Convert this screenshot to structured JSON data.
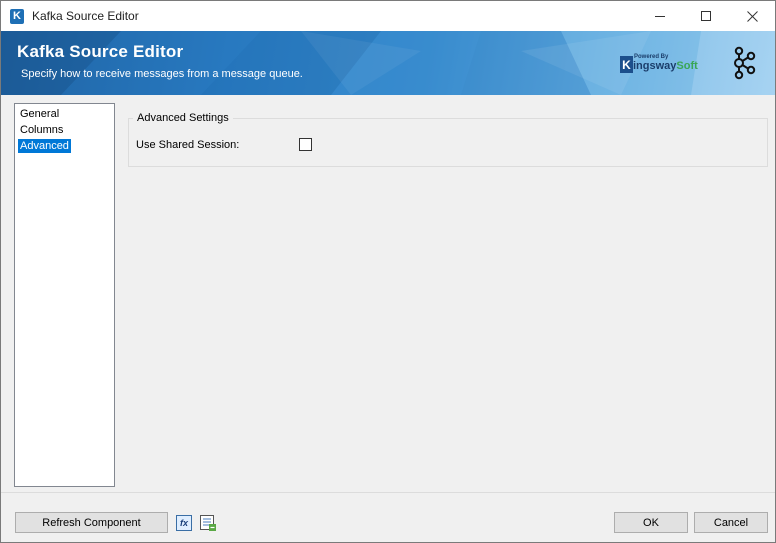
{
  "window": {
    "title": "Kafka Source Editor",
    "icon_letter": "K",
    "controls": [
      "minimize-icon",
      "maximize-icon",
      "close-icon"
    ]
  },
  "banner": {
    "title": "Kafka Source Editor",
    "subtitle": "Specify how to receive messages from a message queue.",
    "brand_powered": "Powered By",
    "brand_k": "K",
    "brand_name_main": "ingsway",
    "brand_name_soft": "Soft",
    "product_logo": "kafka-logo-icon"
  },
  "nav": {
    "items": [
      {
        "label": "General",
        "selected": false
      },
      {
        "label": "Columns",
        "selected": false
      },
      {
        "label": "Advanced",
        "selected": true
      }
    ]
  },
  "advanced": {
    "group_title": "Advanced Settings",
    "use_shared_session_label": "Use Shared Session:",
    "use_shared_session_checked": false
  },
  "footer": {
    "refresh_label": "Refresh Component",
    "fx_icon_text": "fx",
    "ok_label": "OK",
    "cancel_label": "Cancel"
  },
  "colors": {
    "accent": "#0078d7",
    "banner": "#2a7fc7",
    "brand_green": "#3aa655"
  }
}
